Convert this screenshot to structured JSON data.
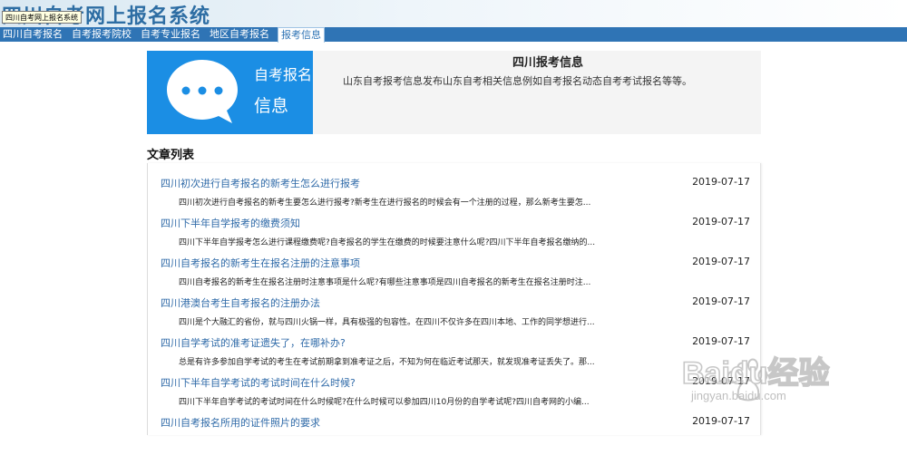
{
  "header": {
    "site_title": "四川自考网上报名系统",
    "tooltip": "四川自考网上报名系统"
  },
  "nav": {
    "items": [
      {
        "label": "四川自考报名"
      },
      {
        "label": "自考报考院校"
      },
      {
        "label": "自考专业报名"
      },
      {
        "label": "地区自考报名"
      },
      {
        "label": "报考信息"
      }
    ],
    "active_index": 4
  },
  "banner": {
    "label_line1": "自考报名",
    "label_line2": "信息",
    "icon": "chat-bubble-icon",
    "title": "四川报考信息",
    "description": "山东自考报考信息发布山东自考相关信息例如自考报名动态自考考试报名等等。"
  },
  "list": {
    "section_title": "文章列表",
    "articles": [
      {
        "title": "四川初次进行自考报名的新考生怎么进行报考",
        "date": "2019-07-17",
        "summary": "四川初次进行自考报名的新考生要怎么进行报考?新考生在进行报名的时候会有一个注册的过程，那么新考生要怎..."
      },
      {
        "title": "四川下半年自学报考的缴费须知",
        "date": "2019-07-17",
        "summary": "四川下半年自学报考怎么进行课程缴费呢?自考报名的学生在缴费的时候要注意什么呢?四川下半年自考报名缴纳的..."
      },
      {
        "title": "四川自考报名的新考生在报名注册的注意事项",
        "date": "2019-07-17",
        "summary": "四川自考报名的新考生在报名注册时注意事项是什么呢?有哪些注意事项是四川自考报名的新考生在报名注册时注..."
      },
      {
        "title": "四川港澳台考生自考报名的注册办法",
        "date": "2019-07-17",
        "summary": "四川是个大融汇的省份，就与四川火锅一样，具有极强的包容性。在四川不仅许多在四川本地、工作的同学想进行..."
      },
      {
        "title": "四川自学考试的准考证遗失了，在哪补办?",
        "date": "2019-07-17",
        "summary": "总是有许多参加自学考试的考生在考试前期拿到准考证之后，不知为何在临近考试那天，就发现准考证丢失了。那..."
      },
      {
        "title": "四川下半年自学考试的考试时间在什么时候?",
        "date": "2019-07-17",
        "summary": "四川下半年自学考试的考试时间在什么时候呢?在什么时候可以参加四川10月份的自学考试呢?四川自考网的小编..."
      },
      {
        "title": "四川自考报名所用的证件照片的要求",
        "date": "2019-07-17",
        "summary": ""
      }
    ]
  },
  "watermark": {
    "brand": "Baidu经验",
    "url": "jingyan.baidu.com"
  },
  "colors": {
    "nav_bg": "#2f74b5",
    "banner_blue": "#1b8ee4",
    "link": "#2f6aa8"
  }
}
